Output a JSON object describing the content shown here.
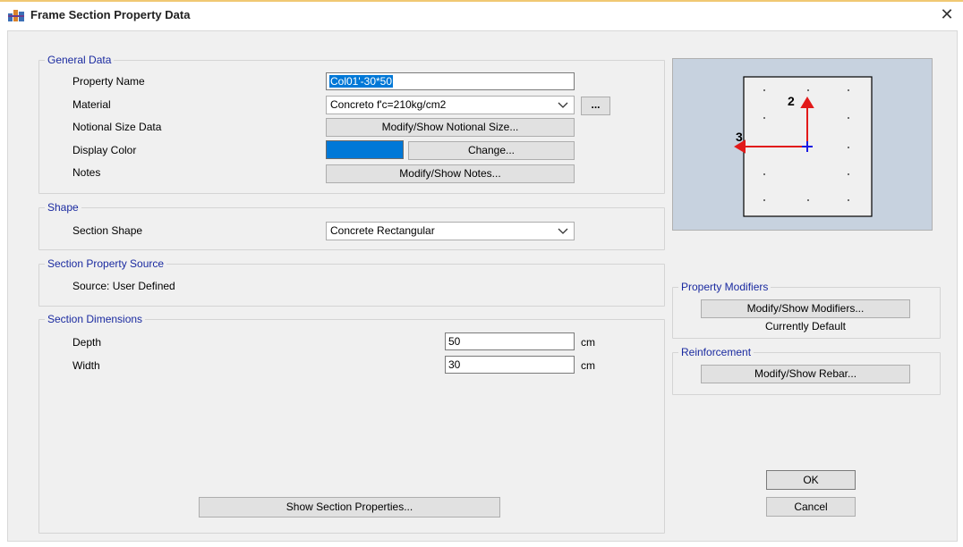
{
  "window": {
    "title": "Frame Section Property Data",
    "close_symbol": "✕"
  },
  "general": {
    "legend": "General Data",
    "property_name_label": "Property Name",
    "property_name_value": "Col01'-30*50",
    "material_label": "Material",
    "material_value": "Concreto f'c=210kg/cm2",
    "material_more": "...",
    "notional_label": "Notional Size Data",
    "notional_button": "Modify/Show Notional Size...",
    "color_label": "Display Color",
    "display_color": "#0078d7",
    "color_button": "Change...",
    "notes_label": "Notes",
    "notes_button": "Modify/Show Notes..."
  },
  "shape": {
    "legend": "Shape",
    "section_shape_label": "Section Shape",
    "section_shape_value": "Concrete Rectangular"
  },
  "source": {
    "legend": "Section Property Source",
    "text": "Source:  User Defined"
  },
  "dimensions": {
    "legend": "Section Dimensions",
    "depth_label": "Depth",
    "depth_value": "50",
    "depth_unit": "cm",
    "width_label": "Width",
    "width_value": "30",
    "width_unit": "cm"
  },
  "preview": {
    "axis_2": "2",
    "axis_3": "3",
    "background_color": "#c7d2df",
    "axis_color": "#e21a1a",
    "centroid_color": "#1a1ae2"
  },
  "modifiers": {
    "legend": "Property Modifiers",
    "button": "Modify/Show Modifiers...",
    "status": "Currently Default"
  },
  "reinforcement": {
    "legend": "Reinforcement",
    "button": "Modify/Show Rebar..."
  },
  "footer": {
    "show_props_button": "Show Section Properties...",
    "ok_button": "OK",
    "cancel_button": "Cancel"
  }
}
